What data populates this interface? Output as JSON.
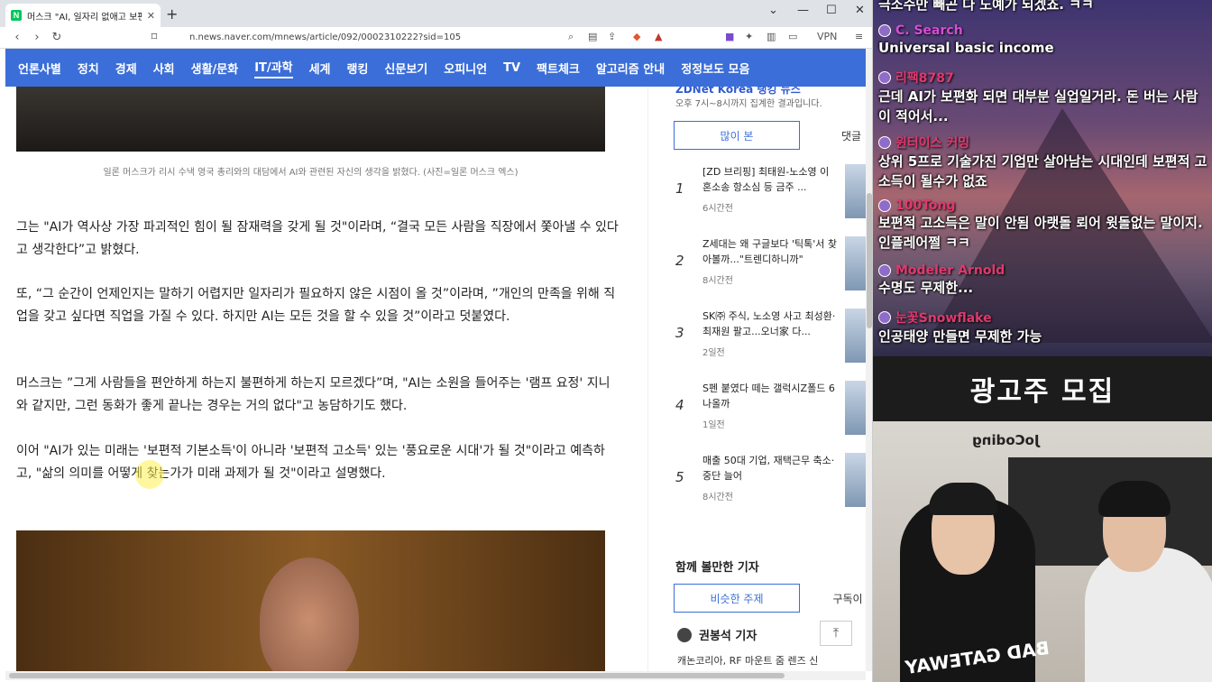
{
  "browser": {
    "tab_title": "머스크 \"AI, 일자리 없애고 보편적",
    "favicon": "N",
    "url": "n.news.naver.com/mnews/article/092/0002310222?sid=105",
    "vpn_label": "VPN"
  },
  "nav": {
    "items": [
      "언론사별",
      "정치",
      "경제",
      "사회",
      "생활/문화",
      "IT/과학",
      "세계",
      "랭킹",
      "신문보기",
      "오피니언",
      "TV",
      "팩트체크",
      "알고리즘 안내",
      "정정보도 모음"
    ],
    "active": "IT/과학"
  },
  "article": {
    "caption": "일론 머스크가 리시 수낵 영국 총리와의 대담에서 AI와 관련된 자신의 생각을 밝혔다. (사진=일론 머스크 엑스)",
    "paragraphs": [
      "그는 \"AI가 역사상 가장 파괴적인 힘이 될 잠재력을 갖게 될 것\"이라며, “결국 모든 사람을 직장에서 쫓아낼 수 있다고 생각한다”고 밝혔다.",
      "또, “그 순간이 언제인지는 말하기 어렵지만 일자리가 필요하지 않은 시점이 올 것”이라며, ”개인의 만족을 위해 직업을 갖고 싶다면 직업을 가질 수 있다. 하지만 AI는 모든 것을 할 수 있을 것”이라고 덧붙였다.",
      "머스크는 ”그게 사람들을 편안하게 하는지 불편하게 하는지 모르겠다”며, \"AI는 소원을 들어주는 '램프 요정' 지니와 같지만, 그런 동화가 좋게 끝나는 경우는 거의 없다\"고 농담하기도 했다.",
      "이어 \"AI가 있는 미래는 '보편적 기본소득'이 아니라 '보편적 고소득' 있는 '풍요로운 시대'가 될 것\"이라고 예측하고, \"삶의 의미를 어떻게 찾는가가 미래 과제가 될 것\"이라고 설명했다."
    ]
  },
  "sidebar": {
    "brand": "ZDNet Korea 랭킹 뉴스",
    "subtitle": "오후 7시~8시까지 집계한 결과입니다.",
    "tab_most_viewed": "많이 본",
    "tab_comments": "댓글",
    "ranking": [
      {
        "num": "1",
        "title": "[ZD 브리핑] 최태원-노소영 이혼소송 항소심 등 금주 ...",
        "time": "6시간전"
      },
      {
        "num": "2",
        "title": "Z세대는 왜 구글보다 '틱톡'서 찾아볼까...\"트렌디하니까\"",
        "time": "8시간전"
      },
      {
        "num": "3",
        "title": "SK㈜ 주식, 노소영 사고 최성환·최재원 팔고...오너家 다...",
        "time": "2일전"
      },
      {
        "num": "4",
        "title": "S펜 붙였다 떼는 갤럭시Z폴드 6 나올까",
        "time": "1일전"
      },
      {
        "num": "5",
        "title": "매출 50대 기업, 재택근무 축소·중단 늘어",
        "time": "8시간전"
      }
    ],
    "reporters_heading": "함께 볼만한 기자",
    "tab_similar": "비슷한 주제",
    "tab_subscribe": "구독이",
    "reporter_name": "권봉석 기자",
    "reporter_article": "캐논코리아, RF 마운트 줌 렌즈 신"
  },
  "chat": {
    "messages": [
      {
        "user": "",
        "text": "극소수만 빼곤 다 노예가 되겠죠. ㅋㅋ",
        "color": "#ffffff"
      },
      {
        "user": "C. Search",
        "text": "Universal basic income",
        "color": "#d64dd6"
      },
      {
        "user": "리팩8787",
        "text": "근데 AI가 보편화 되면 대부분 실업일거라. 돈 버는 사람이 적어서...",
        "color": "#e0396e"
      },
      {
        "user": "윈터이스 커밍",
        "text": "상위 5프로 기술가진 기업만 살아남는 시대인데 보편적 고소득이 될수가 없죠",
        "color": "#e0396e"
      },
      {
        "user": "100Tong",
        "text": "보편적 고소득은 말이 안됨 아랫돌 뢰어 윗돌없는 말이지. 인플레어쩔 ㅋㅋ",
        "color": "#e0396e"
      },
      {
        "user": "Modeler Arnold",
        "text": "수명도 무제한...",
        "color": "#e0396e"
      },
      {
        "user": "눈꽃Snowflake",
        "text": "인공태양 만들면 무제한 가능",
        "color": "#e0396e"
      }
    ]
  },
  "banner": {
    "text": "광고주 모집"
  },
  "webcam": {
    "neon": "JoCoding",
    "shirt": "BAD GATEWAY"
  }
}
